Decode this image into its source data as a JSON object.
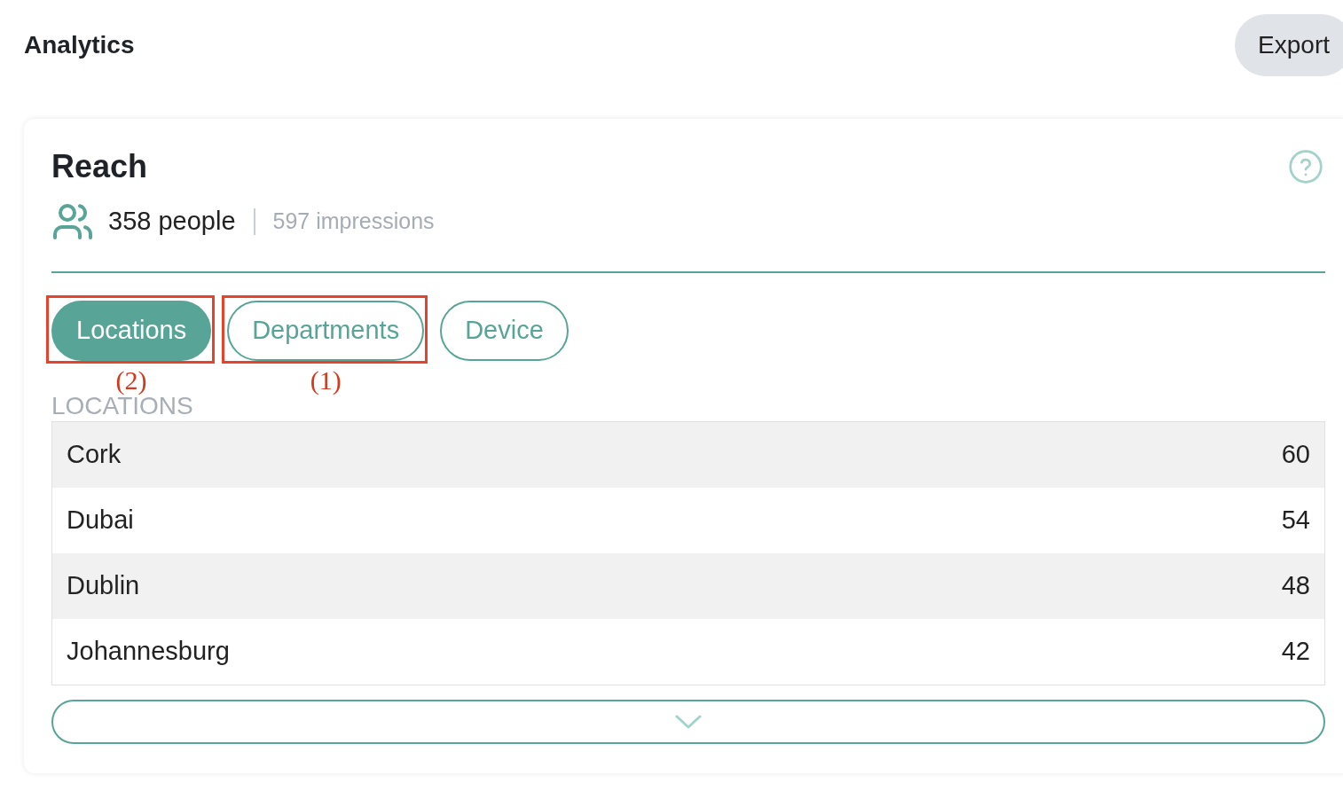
{
  "header": {
    "title": "Analytics",
    "export_button": "Export"
  },
  "reach_card": {
    "title": "Reach",
    "people": "358 people",
    "impressions": "597 impressions",
    "tabs": [
      {
        "label": "Locations",
        "selected": true,
        "annotation": "(2)"
      },
      {
        "label": "Departments",
        "selected": false,
        "annotation": "(1)"
      },
      {
        "label": "Device",
        "selected": false
      }
    ],
    "section_label": "LOCATIONS",
    "rows": [
      {
        "name": "Cork",
        "count": "60"
      },
      {
        "name": "Dubai",
        "count": "54"
      },
      {
        "name": "Dublin",
        "count": "48"
      },
      {
        "name": "Johannesburg",
        "count": "42"
      }
    ]
  }
}
